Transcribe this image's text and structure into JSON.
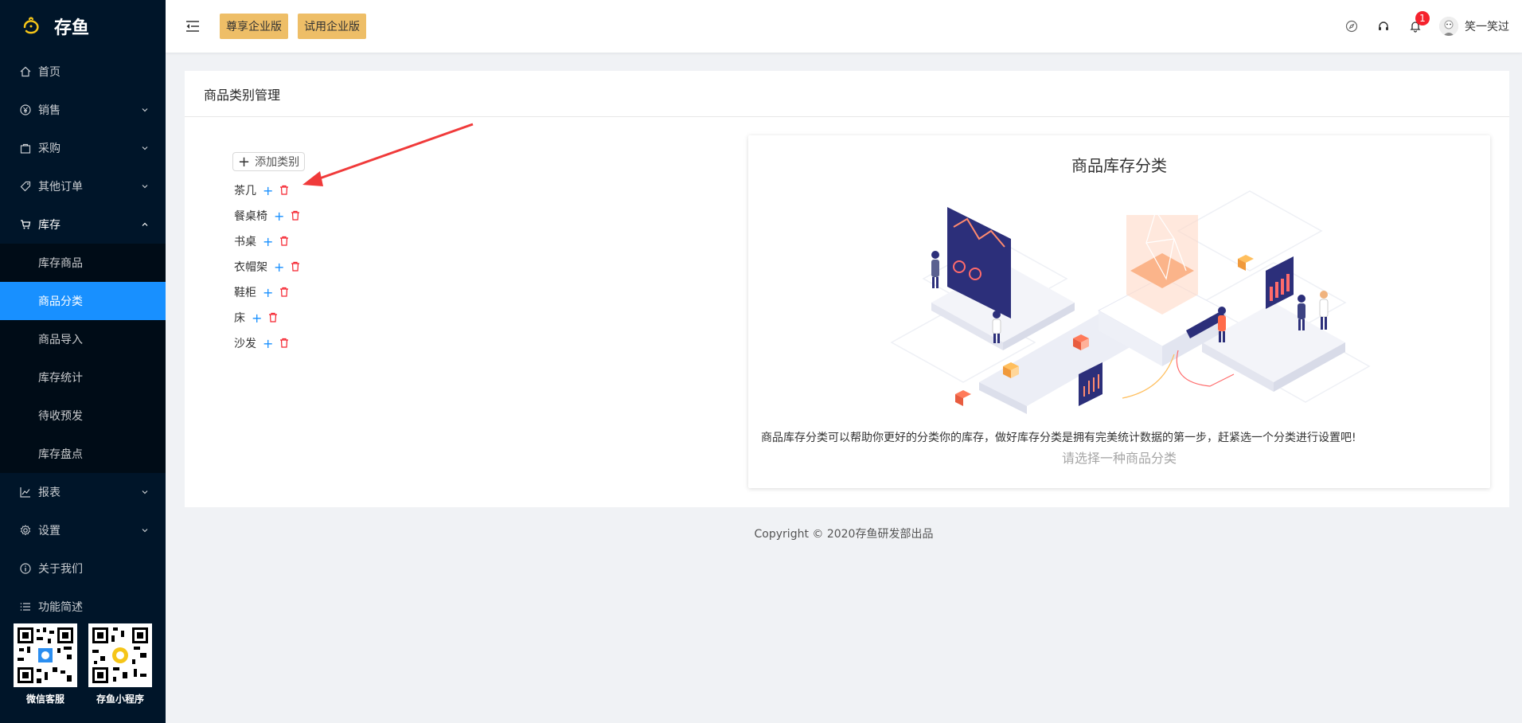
{
  "brand": {
    "name": "存鱼"
  },
  "sidebar": {
    "items": [
      {
        "label": "首页",
        "icon": "home-icon"
      },
      {
        "label": "销售",
        "icon": "yen-icon"
      },
      {
        "label": "采购",
        "icon": "bag-icon"
      },
      {
        "label": "其他订单",
        "icon": "tag-icon"
      },
      {
        "label": "库存",
        "icon": "cart-icon"
      },
      {
        "label": "报表",
        "icon": "chart-icon"
      },
      {
        "label": "设置",
        "icon": "gear-icon"
      },
      {
        "label": "关于我们",
        "icon": "info-icon"
      },
      {
        "label": "功能简述",
        "icon": "list-icon"
      }
    ],
    "inventory_sub": [
      "库存商品",
      "商品分类",
      "商品导入",
      "库存统计",
      "待收预发",
      "库存盘点"
    ],
    "qr": [
      {
        "label": "微信客服"
      },
      {
        "label": "存鱼小程序"
      }
    ]
  },
  "header": {
    "badge1": "尊享企业版",
    "badge2": "试用企业版",
    "notification_count": "1",
    "username": "笑一笑过"
  },
  "main": {
    "title": "商品类别管理",
    "add_label": "添加类别",
    "categories": [
      "茶几",
      "餐桌椅",
      "书桌",
      "衣帽架",
      "鞋柜",
      "床",
      "沙发"
    ],
    "panel_title": "商品库存分类",
    "panel_desc": "商品库存分类可以帮助你更好的分类你的库存，做好库存分类是拥有完美统计数据的第一步，赶紧选一个分类进行设置吧!",
    "panel_hint": "请选择一种商品分类"
  },
  "footer": {
    "text": "Copyright © 2020存鱼研发部出品"
  },
  "colors": {
    "sidebar_bg": "#001529",
    "active": "#1890ff",
    "badge": "#eebe67",
    "delete": "#f5222d",
    "notif": "#f5222d"
  }
}
